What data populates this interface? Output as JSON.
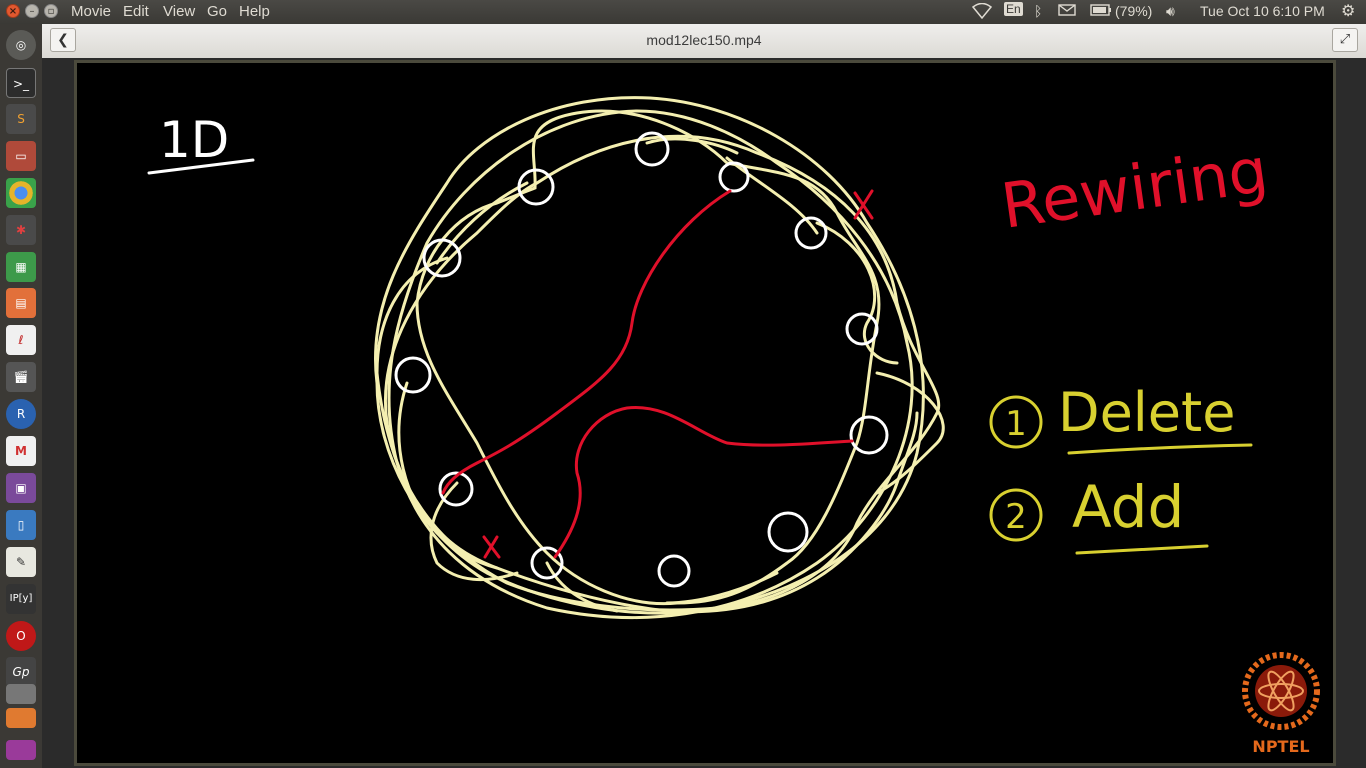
{
  "menu": {
    "items": [
      "Movie",
      "Edit",
      "View",
      "Go",
      "Help"
    ]
  },
  "tray": {
    "language": "En",
    "battery": "(79%)",
    "datetime": "Tue Oct 10  6:10 PM"
  },
  "window": {
    "title": "mod12lec150.mp4"
  },
  "launcher": {
    "apps": [
      "dash-icon",
      "terminal-icon",
      "sublime-icon",
      "files-icon",
      "chrome-icon",
      "settings-icon",
      "spreadsheet-icon",
      "presentation-icon",
      "pdf-icon",
      "video-editor-icon",
      "r-icon",
      "gmail-icon",
      "media-icon",
      "document-icon",
      "text-editor-icon",
      "ipython-icon",
      "opera-icon",
      "gnuplot-icon",
      "disks-icon",
      "software-icon",
      "trash-icon"
    ]
  },
  "board": {
    "heading": "1D",
    "title": "Rewiring",
    "steps": [
      {
        "number": "1",
        "label": "Delete"
      },
      {
        "number": "2",
        "label": "Add"
      }
    ],
    "logo_text": "NPTEL"
  },
  "colors": {
    "yellow_ink": "#f4efb0",
    "red_ink": "#e0102a",
    "step_ink": "#d8d030",
    "white_ink": "#ffffff",
    "logo": "#e4691c"
  }
}
